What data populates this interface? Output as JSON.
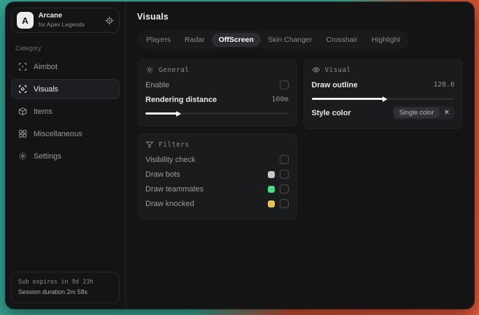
{
  "background": {
    "gradient_start": "#38a492",
    "gradient_end": "#e15a3c"
  },
  "app": {
    "logo_letter": "A",
    "name": "Arcane",
    "subtitle": "for Apex Legends"
  },
  "sidebar": {
    "category_label": "Category",
    "items": [
      {
        "label": "Aimbot",
        "icon": "crosshair-icon",
        "selected": false
      },
      {
        "label": "Visuals",
        "icon": "eye-scan-icon",
        "selected": true
      },
      {
        "label": "Items",
        "icon": "box-icon",
        "selected": false
      },
      {
        "label": "Miscellaneous",
        "icon": "grid-icon",
        "selected": false
      },
      {
        "label": "Settings",
        "icon": "gear-icon",
        "selected": false
      }
    ],
    "footer": {
      "sub_expires": "Sub expires in 9d 23h",
      "session_duration": "Session duration 2m 58s"
    }
  },
  "header": {
    "title": "Visuals"
  },
  "tabs": [
    {
      "label": "Players",
      "selected": false
    },
    {
      "label": "Radar",
      "selected": false
    },
    {
      "label": "OffScreen",
      "selected": true
    },
    {
      "label": "Skin Changer",
      "selected": false
    },
    {
      "label": "Crosshair",
      "selected": false
    },
    {
      "label": "Highlight",
      "selected": false
    }
  ],
  "panels": {
    "general": {
      "title": "General",
      "icon": "sun-icon",
      "enable_label": "Enable",
      "enable_checked": false,
      "rendering_label": "Rendering distance",
      "rendering_value": "100m",
      "rendering_fill": "22%"
    },
    "filters": {
      "title": "Filters",
      "icon": "funnel-icon",
      "rows": [
        {
          "label": "Visibility check",
          "checked": false
        },
        {
          "label": "Draw bots",
          "swatch": "#c9c9c9",
          "checked": false
        },
        {
          "label": "Draw teammates",
          "swatch": "#4cd97f",
          "checked": false
        },
        {
          "label": "Draw knocked",
          "swatch": "#e5c54e",
          "checked": false
        }
      ]
    },
    "visual": {
      "title": "Visual",
      "icon": "eye-icon",
      "outline_label": "Draw outline",
      "outline_value": "128.0",
      "outline_fill": "50%",
      "style_label": "Style color",
      "style_tag": "Single color"
    }
  }
}
